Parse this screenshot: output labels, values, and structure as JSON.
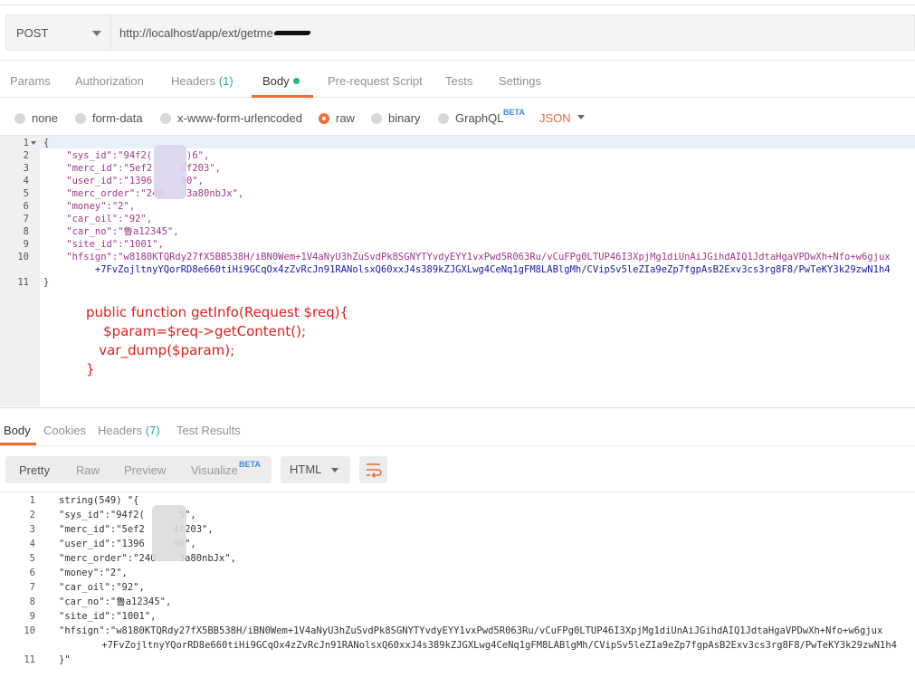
{
  "request": {
    "method": "POST",
    "url": "http://localhost/app/ext/getme"
  },
  "tabs": [
    {
      "label": "Params"
    },
    {
      "label": "Authorization"
    },
    {
      "label": "Headers",
      "count": "(1)"
    },
    {
      "label": "Body"
    },
    {
      "label": "Pre-request Script"
    },
    {
      "label": "Tests"
    },
    {
      "label": "Settings"
    }
  ],
  "body_types": {
    "none": "none",
    "form_data": "form-data",
    "urlencoded": "x-www-form-urlencoded",
    "raw": "raw",
    "binary": "binary",
    "graphql": "GraphQL",
    "beta": "BETA",
    "format": "JSON"
  },
  "editor": {
    "lines": [
      {
        "n": "1",
        "text": "{"
      },
      {
        "n": "2",
        "text": "    \"sys_id\":\"94f2(      )6\","
      },
      {
        "n": "3",
        "text": "    \"merc_id\":\"5ef2     4f203\","
      },
      {
        "n": "4",
        "text": "    \"user_id\":\"1396     90\","
      },
      {
        "n": "5",
        "text": "    \"merc_order\":\"240    3a80nbJx\","
      },
      {
        "n": "6",
        "text": "    \"money\":\"2\","
      },
      {
        "n": "7",
        "text": "    \"car_oil\":\"92\","
      },
      {
        "n": "8",
        "text": "    \"car_no\":\"鲁a12345\","
      },
      {
        "n": "9",
        "text": "    \"site_id\":\"1001\","
      },
      {
        "n": "10",
        "text": "    \"hfsign\":\"w8180KTQRdy27fX5BB538H/iBN0Wem+1V4aNyU3hZuSvdPk8SGNYTYvdyEYY1vxPwd5R063Ru/vCuFPg0LTUP46I3XpjMg1diUnAiJGihdAIQ1JdtaHgaVPDwXh+Nfo+w6gjux"
      },
      {
        "n": "",
        "text": "         +7FvZojltnyYQorRD8e660tiHi9GCqOx4zZvRcJn91RANolsxQ60xxJ4s389kZJGXLwg4CeNq1gFM8LABlgMh/CVipSv5leZIa9eZp7fgpAsB2Exv3cs3rg8F8/PwTeKY3k29zwN1h4"
      },
      {
        "n": "11",
        "text": "}"
      }
    ],
    "annotation": [
      "public function getInfo(Request $req){",
      "    $param=$req->getContent();",
      "   var_dump($param);",
      "}"
    ]
  },
  "response": {
    "tabs": [
      {
        "label": "Body"
      },
      {
        "label": "Cookies"
      },
      {
        "label": "Headers",
        "count": "(7)"
      },
      {
        "label": "Test Results"
      }
    ],
    "views": {
      "pretty": "Pretty",
      "raw": "Raw",
      "preview": "Preview",
      "visualize": "Visualize",
      "beta": "BETA",
      "format": "HTML"
    },
    "lines": [
      {
        "n": "1",
        "text": "string(549) \"{"
      },
      {
        "n": "2",
        "text": "\"sys_id\":\"94f2(      5\","
      },
      {
        "n": "3",
        "text": "\"merc_id\":\"5ef2     4f203\","
      },
      {
        "n": "4",
        "text": "\"user_id\":\"1396     90\","
      },
      {
        "n": "5",
        "text": "\"merc_order\":\"240    3a80nbJx\","
      },
      {
        "n": "6",
        "text": "\"money\":\"2\","
      },
      {
        "n": "7",
        "text": "\"car_oil\":\"92\","
      },
      {
        "n": "8",
        "text": "\"car_no\":\"鲁a12345\","
      },
      {
        "n": "9",
        "text": "\"site_id\":\"1001\","
      },
      {
        "n": "10",
        "text": "\"hfsign\":\"w8180KTQRdy27fX5BB538H/iBN0Wem+1V4aNyU3hZuSvdPk8SGNYTYvdyEYY1vxPwd5R063Ru/vCuFPg0LTUP46I3XpjMg1diUnAiJGihdAIQ1JdtaHgaVPDwXh+Nfo+w6gjux"
      },
      {
        "n": "",
        "text": "    +7FvZojltnyYQorRD8e660tiHi9GCqOx4zZvRcJn91RANolsxQ60xxJ4s389kZJGXLwg4CeNq1gFM8LABlgMh/CVipSv5leZIa9eZp7fgpAsB2Exv3cs3rg8F8/PwTeKY3k29zwN1h4"
      },
      {
        "n": "11",
        "text": "}\""
      }
    ]
  }
}
